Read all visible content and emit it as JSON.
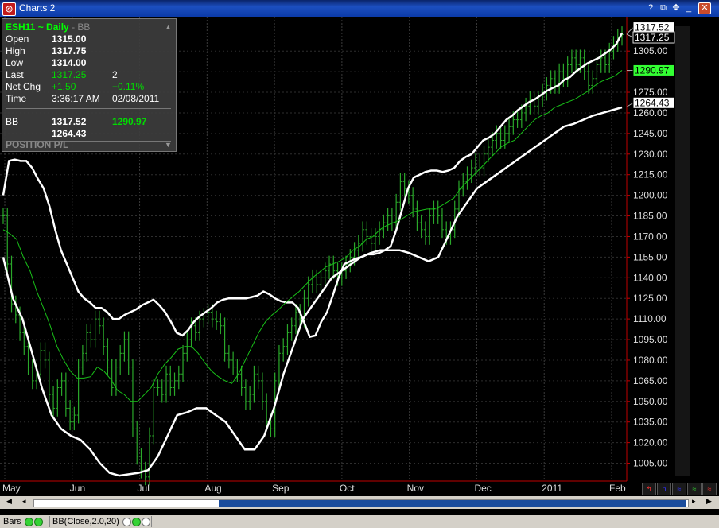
{
  "window": {
    "title": "Charts 2",
    "app_icon": "chart-app-icon"
  },
  "info_panel": {
    "symbol": "ESH11 ~ Daily",
    "sep": "-",
    "study": "BB",
    "open_label": "Open",
    "open_value": "1315.00",
    "high_label": "High",
    "high_value": "1317.75",
    "low_label": "Low",
    "low_value": "1314.00",
    "last_label": "Last",
    "last_value": "1317.25",
    "last_size": "2",
    "netchg_label": "Net Chg",
    "netchg_value": "+1.50",
    "netchg_pct": "+0.11%",
    "time_label": "Time",
    "time_value": "3:36:17 AM",
    "date_value": "02/08/2011",
    "bb_label": "BB",
    "bb_upper": "1317.52",
    "bb_mid": "1290.97",
    "bb_lower": "1264.43",
    "position_label": "POSITION P/L"
  },
  "status": {
    "bars_label": "Bars",
    "study_label": "BB(Close,2.0,20)"
  },
  "toolbar_icons": [
    "trendline-icon",
    "text-icon",
    "zoom-icon",
    "cycle-icon",
    "wave-icon"
  ],
  "colors": {
    "price_bars": "#2aa82a",
    "bands": "#ffffff",
    "middle_band": "#18c018",
    "axis_red": "#c00000",
    "last_price": "#33ff33"
  },
  "chart_data": {
    "type": "line",
    "title": "ESH11 ~ Daily",
    "ylim": [
      992,
      1330
    ],
    "y_ticks": [
      1005,
      1020,
      1035,
      1050,
      1065,
      1080,
      1095,
      1110,
      1125,
      1140,
      1155,
      1170,
      1185,
      1200,
      1215,
      1230,
      1245,
      1260,
      1275,
      1290,
      1305
    ],
    "x_labels": [
      "May",
      "Jun",
      "Jul",
      "Aug",
      "Sep",
      "Oct",
      "Nov",
      "Dec",
      "2011",
      "Feb"
    ],
    "price_labels": {
      "upper": "1317.52",
      "last": "1317.25",
      "middle": "1290.97",
      "lower": "1264.43"
    },
    "series": [
      {
        "name": "Close",
        "values": [
          1185,
          1150,
          1121,
          1113,
          1100,
          1090,
          1075,
          1065,
          1070,
          1087,
          1080,
          1055,
          1045,
          1060,
          1065,
          1045,
          1035,
          1040,
          1075,
          1085,
          1100,
          1095,
          1110,
          1105,
          1090,
          1075,
          1060,
          1075,
          1085,
          1095,
          1075,
          1030,
          1010,
          1000,
          995,
          1025,
          1060,
          1060,
          1055,
          1070,
          1060,
          1065,
          1070,
          1085,
          1095,
          1105,
          1100,
          1110,
          1112,
          1115,
          1110,
          1108,
          1105,
          1085,
          1080,
          1075,
          1070,
          1060,
          1050,
          1055,
          1070,
          1065,
          1050,
          1035,
          1030,
          1065,
          1085,
          1090,
          1100,
          1105,
          1115,
          1110,
          1125,
          1135,
          1140,
          1135,
          1140,
          1145,
          1150,
          1145,
          1140,
          1145,
          1150,
          1155,
          1160,
          1165,
          1175,
          1170,
          1165,
          1170,
          1175,
          1180,
          1185,
          1180,
          1195,
          1210,
          1205,
          1200,
          1190,
          1180,
          1175,
          1170,
          1185,
          1190,
          1185,
          1175,
          1170,
          1175,
          1190,
          1205,
          1210,
          1215,
          1220,
          1225,
          1220,
          1230,
          1235,
          1240,
          1245,
          1240,
          1245,
          1250,
          1255,
          1255,
          1260,
          1265,
          1270,
          1265,
          1270,
          1275,
          1280,
          1285,
          1280,
          1290,
          1285,
          1295,
          1300,
          1295,
          1300,
          1290,
          1280,
          1285,
          1295,
          1300,
          1295,
          1305,
          1310,
          1315,
          1317
        ]
      },
      {
        "name": "BB Upper",
        "values": [
          1200,
          1225,
          1226,
          1225,
          1225,
          1220,
          1212,
          1205,
          1192,
          1175,
          1160,
          1150,
          1140,
          1130,
          1125,
          1122,
          1118,
          1118,
          1115,
          1110,
          1110,
          1113,
          1115,
          1117,
          1120,
          1122,
          1124,
          1120,
          1115,
          1108,
          1100,
          1098,
          1102,
          1108,
          1112,
          1115,
          1118,
          1122,
          1124,
          1125,
          1125,
          1125,
          1125,
          1126,
          1127,
          1130,
          1128,
          1125,
          1123,
          1122,
          1122,
          1118,
          1108,
          1097,
          1098,
          1108,
          1115,
          1127,
          1140,
          1150,
          1152,
          1154,
          1155,
          1157,
          1157,
          1158,
          1160,
          1163,
          1175,
          1190,
          1205,
          1213,
          1215,
          1217,
          1218,
          1218,
          1217,
          1218,
          1220,
          1225,
          1228,
          1230,
          1235,
          1240,
          1242,
          1245,
          1250,
          1255,
          1258,
          1262,
          1265,
          1268,
          1270,
          1273,
          1276,
          1278,
          1280,
          1284,
          1286,
          1290,
          1293,
          1296,
          1298,
          1300,
          1303,
          1306,
          1310,
          1318
        ]
      },
      {
        "name": "BB Middle",
        "values": [
          1175,
          1172,
          1168,
          1155,
          1145,
          1130,
          1118,
          1105,
          1090,
          1080,
          1072,
          1067,
          1067,
          1068,
          1075,
          1072,
          1066,
          1058,
          1055,
          1050,
          1050,
          1055,
          1060,
          1070,
          1077,
          1082,
          1088,
          1090,
          1090,
          1085,
          1078,
          1072,
          1068,
          1065,
          1063,
          1070,
          1080,
          1090,
          1100,
          1108,
          1113,
          1117,
          1122,
          1126,
          1130,
          1135,
          1140,
          1144,
          1148,
          1150,
          1152,
          1155,
          1160,
          1163,
          1168,
          1170,
          1175,
          1178,
          1180,
          1182,
          1185,
          1188,
          1189,
          1190,
          1190,
          1192,
          1195,
          1198,
          1205,
          1210,
          1215,
          1220,
          1225,
          1230,
          1235,
          1238,
          1240,
          1245,
          1250,
          1255,
          1258,
          1260,
          1264,
          1266,
          1268,
          1270,
          1273,
          1276,
          1280,
          1283,
          1285,
          1287,
          1291
        ]
      },
      {
        "name": "BB Lower",
        "values": [
          1155,
          1125,
          1110,
          1085,
          1060,
          1040,
          1030,
          1025,
          1022,
          1015,
          1005,
          998,
          996,
          997,
          998,
          1000,
          1010,
          1025,
          1040,
          1042,
          1045,
          1045,
          1040,
          1035,
          1025,
          1015,
          1015,
          1025,
          1045,
          1070,
          1090,
          1110,
          1120,
          1130,
          1140,
          1145,
          1150,
          1155,
          1158,
          1160,
          1160,
          1160,
          1158,
          1155,
          1152,
          1155,
          1170,
          1185,
          1195,
          1205,
          1210,
          1215,
          1220,
          1225,
          1230,
          1235,
          1240,
          1245,
          1250,
          1252,
          1255,
          1258,
          1260,
          1262,
          1264
        ]
      }
    ]
  }
}
